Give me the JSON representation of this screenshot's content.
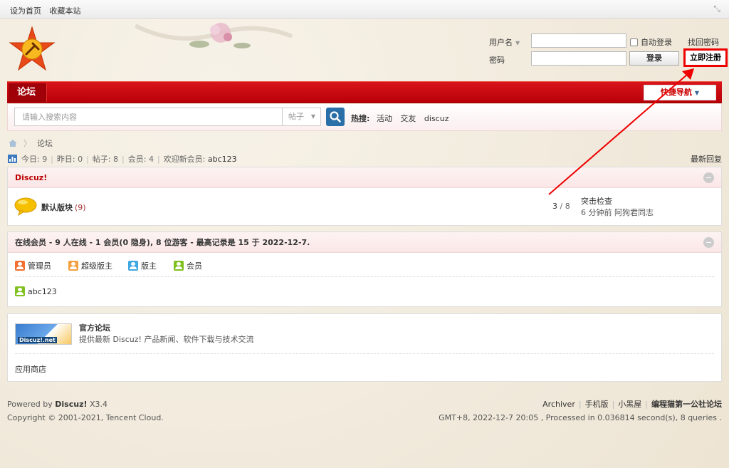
{
  "topbar": {
    "set_homepage": "设为首页",
    "bookmark": "收藏本站"
  },
  "login": {
    "username_label": "用户名",
    "password_label": "密码",
    "auto_login": "自动登录",
    "forgot_password": "找回密码",
    "login_button": "登录",
    "register_button": "立即注册"
  },
  "nav": {
    "forum_tab": "论坛",
    "quick_nav": "快捷导航"
  },
  "search": {
    "placeholder": "请输入搜索内容",
    "type": "帖子",
    "hot_label": "热搜:",
    "keywords": [
      "活动",
      "交友",
      "discuz"
    ]
  },
  "breadcrumb": {
    "current": "论坛"
  },
  "stats": {
    "today": "今日: 9",
    "yesterday": "昨日: 0",
    "posts": "帖子: 8",
    "members": "会员: 4",
    "welcome": "欢迎新会员:",
    "newest_member": "abc123",
    "latest_reply": "最新回复"
  },
  "category": {
    "title": "Discuz!",
    "forum": {
      "name": "默认版块",
      "count": "(9)",
      "threads": "3",
      "posts_sep": "/ 8",
      "last_title": "突击检查",
      "last_meta": "6 分钟前  阿狗君同志"
    }
  },
  "online": {
    "title": "在线会员 - 9 人在线 - 1 会员(0 隐身), 8 位游客 - 最高记录是 15 于 2022-12-7.",
    "legend": [
      "管理员",
      "超级版主",
      "版主",
      "会员"
    ],
    "users": [
      "abc123"
    ]
  },
  "links": {
    "logo_text": "Discuz!.net",
    "title": "官方论坛",
    "desc": "提供最新 Discuz! 产品新闻、软件下载与技术交流",
    "app_store": "应用商店"
  },
  "footer": {
    "powered_prefix": "Powered by",
    "powered_brand": "Discuz!",
    "powered_version": "X3.4",
    "copyright": "Copyright © 2001-2021, Tencent Cloud.",
    "links": [
      "Archiver",
      "手机版",
      "小黑屋"
    ],
    "site_name": "编程猫第一公社论坛",
    "timing": "GMT+8, 2022-12-7 20:05 , Processed in 0.036814 second(s), 8 queries ."
  },
  "colors": {
    "nav_red": "#c8101a",
    "register_border": "#e00000",
    "search_button": "#2b6fa8"
  }
}
